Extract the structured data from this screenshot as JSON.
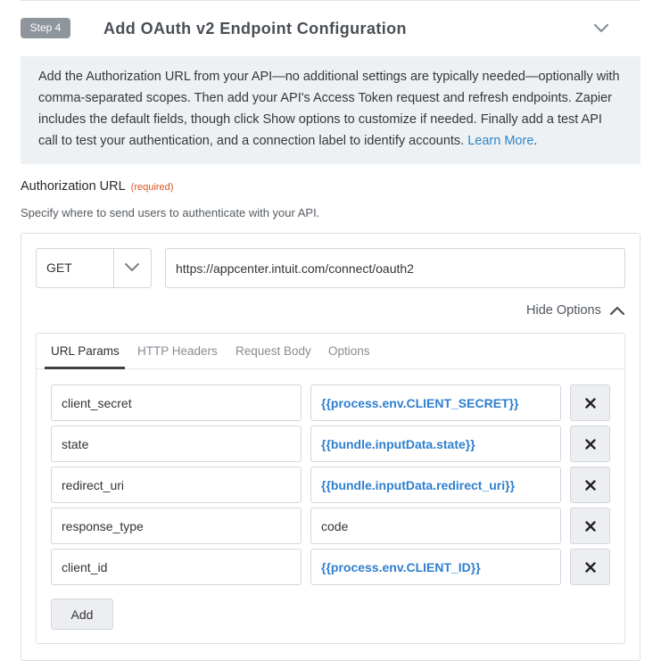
{
  "step": {
    "badge": "Step 4",
    "title": "Add OAuth v2 Endpoint Configuration",
    "collapse_icon": "chevron-down-icon"
  },
  "intro": {
    "text": "Add the Authorization URL from your API—no additional settings are typically needed—optionally with comma-separated scopes. Then add your API's Access Token request and refresh endpoints. Zapier includes the default fields, though click Show options to customize if needed. Finally add a test API call to test your authentication, and a connection label to identify accounts.",
    "link": "Learn More",
    "after_link": "."
  },
  "auth_url": {
    "label": "Authorization URL",
    "required": "(required)",
    "help": "Specify where to send users to authenticate with your API.",
    "method": "GET",
    "url": "https://appcenter.intuit.com/connect/oauth2",
    "hide_options": "Hide Options"
  },
  "tabs": [
    {
      "label": "URL Params",
      "active": true
    },
    {
      "label": "HTTP Headers",
      "active": false
    },
    {
      "label": "Request Body",
      "active": false
    },
    {
      "label": "Options",
      "active": false
    }
  ],
  "params": [
    {
      "key": "client_secret",
      "value": "{{process.env.CLIENT_SECRET}}",
      "token": true
    },
    {
      "key": "state",
      "value": "{{bundle.inputData.state}}",
      "token": true
    },
    {
      "key": "redirect_uri",
      "value": "{{bundle.inputData.redirect_uri}}",
      "token": true
    },
    {
      "key": "response_type",
      "value": "code",
      "token": false
    },
    {
      "key": "client_id",
      "value": "{{process.env.CLIENT_ID}}",
      "token": true
    }
  ],
  "add_button": "Add",
  "colors": {
    "accent_link": "#2e86c9",
    "token_text": "#2e7fcf",
    "required": "#e0531b",
    "badge_bg": "#8f959c",
    "intro_bg": "#eef1f3"
  }
}
